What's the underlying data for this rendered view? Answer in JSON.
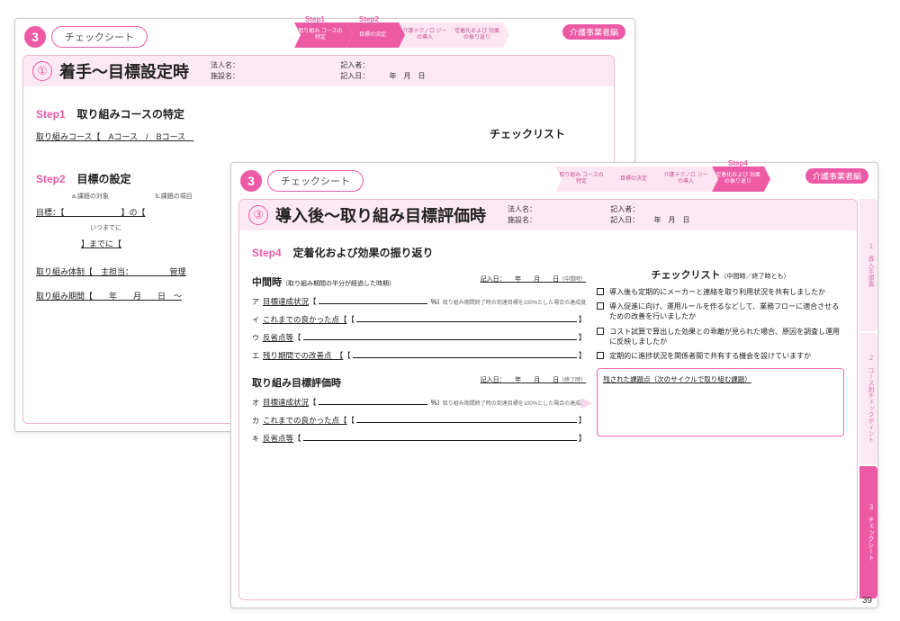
{
  "common": {
    "tab_number": "3",
    "tab_label": "チェックシート",
    "badge": "介護事業者編",
    "meta_houjin": "法人名：",
    "meta_shisetsu": "施設名：",
    "meta_kijinsha": "記入者：",
    "meta_kijinbi": "記入日：",
    "meta_date": "年　月　日"
  },
  "progress_back": {
    "step1": "Step1",
    "step2": "Step2",
    "items": [
      "取り組み\nコースの特定",
      "目標の決定",
      "介護テクノロ\nジーの導入",
      "定着化および\n効果の振り返り"
    ],
    "active": [
      0,
      1
    ]
  },
  "progress_front": {
    "step4": "Step4",
    "items": [
      "取り組み\nコースの特定",
      "目標の決定",
      "介護テクノロ\nジーの導入",
      "定着化および\n効果の振り返り"
    ],
    "active": [
      3
    ]
  },
  "back": {
    "circle": "①",
    "title": "着手～目標設定時",
    "s1_step": "Step1",
    "s1_title": "取り組みコースの特定",
    "s1_line": "取り組みコース【　Aコース　/　Bコース　",
    "cl_title": "チェックリスト",
    "s2_step": "Step2",
    "s2_title": "目標の設定",
    "s2_a": "a.課題の対象",
    "s2_b": "b.課題の項目",
    "s2_target": "目標：【　　　　　　　】の【",
    "s2_when": "いつまでに",
    "s2_until": "】までに【",
    "s2_taisei": "取り組み体制【　主担当：　　　　　管理",
    "s2_kikan": "取り組み期間【　　年　　月　　日　～"
  },
  "front": {
    "circle": "③",
    "title": "導入後～取り組み目標評価時",
    "step": "Step4",
    "step_title": "定着化および効果の振り返り",
    "mid_h": "中間時",
    "mid_sub": "（取り組み期間の半分が経過した時期）",
    "entry_label": "記入日：　　年　　月　　日",
    "entry_note_mid": "（中間時）",
    "entry_note_end": "（終了時）",
    "items_mid": [
      {
        "k": "ア",
        "t": "目標達成状況",
        "tail": "】取り組み期間終了時の到達目標を100%とした場合の達成度",
        "pct": true
      },
      {
        "k": "イ",
        "t": "これまでの良かった点【"
      },
      {
        "k": "ウ",
        "t": "反省点等"
      },
      {
        "k": "エ",
        "t": "残り期間での改善点　【"
      }
    ],
    "eval_h": "取り組み目標評価時",
    "items_end": [
      {
        "k": "オ",
        "t": "目標達成状況",
        "tail": "】取り組み期間終了時の到達目標を100%とした場合の達成度",
        "pct": true
      },
      {
        "k": "カ",
        "t": "これまでの良かった点【"
      },
      {
        "k": "キ",
        "t": "反省点等"
      }
    ],
    "cl_title": "チェックリスト",
    "cl_sub": "（中間時／終了時とも）",
    "cl_items": [
      "導入後も定期的にメーカーと連絡を取り利用状況を共有しましたか",
      "導入促進に向け、運用ルールを作るなどして、業務フローに適合させるための改善を行いましたか",
      "コスト試算で算出した効果との乖離が見られた場合、原因を調査し運用に反映しましたか",
      "定期的に進捗状況を関係者間で共有する機会を設けていますか"
    ],
    "resbox": "残された課題点（次のサイクルで取り組む課題）",
    "sidetabs": [
      "１　導入手順書",
      "２　コース別チェックポイント",
      "３　チェックシート"
    ],
    "page": "39"
  }
}
